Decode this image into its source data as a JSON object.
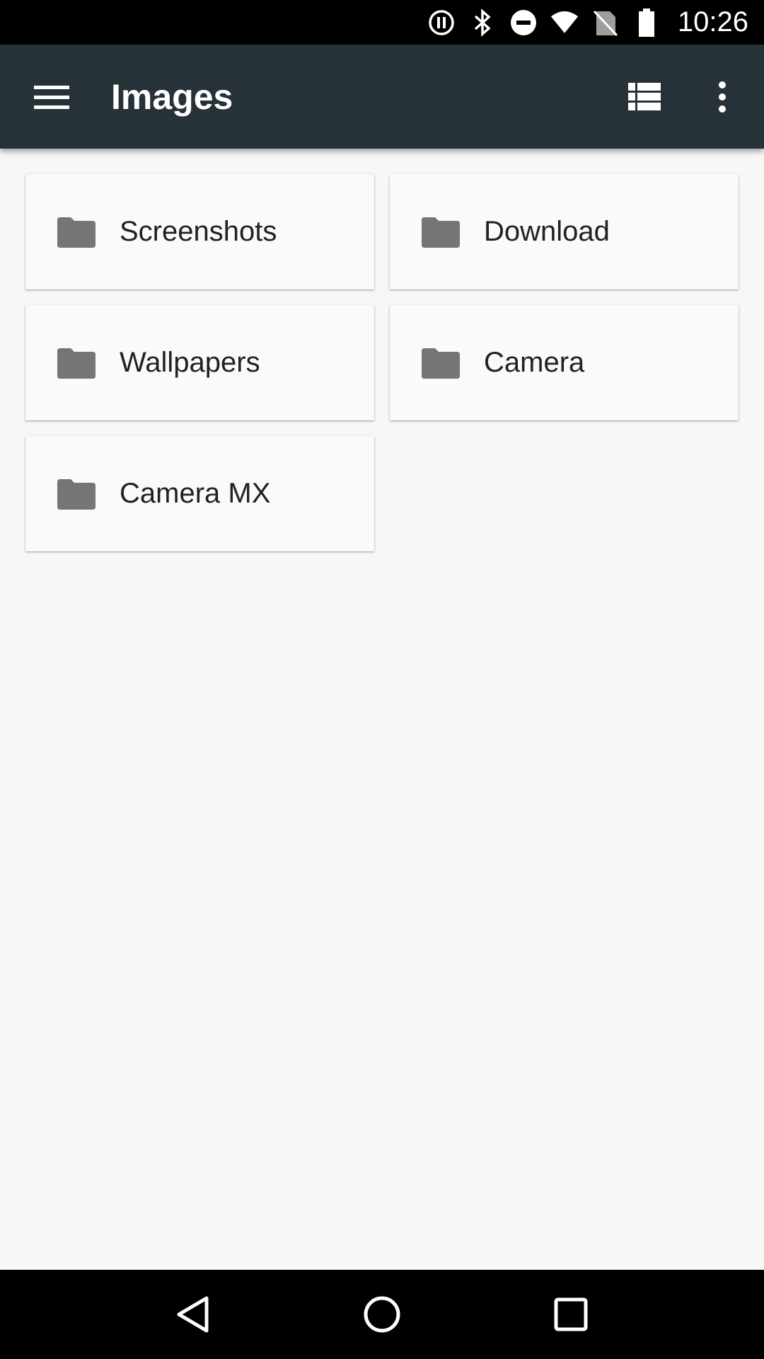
{
  "status_bar": {
    "time": "10:26"
  },
  "toolbar": {
    "title": "Images"
  },
  "folders": [
    {
      "name": "Screenshots"
    },
    {
      "name": "Download"
    },
    {
      "name": "Wallpapers"
    },
    {
      "name": "Camera"
    },
    {
      "name": "Camera MX"
    }
  ],
  "colors": {
    "toolbar": "#263238",
    "background": "#f7f7f7",
    "card": "#fafafa",
    "folder_icon": "#757575",
    "text": "#212121"
  }
}
